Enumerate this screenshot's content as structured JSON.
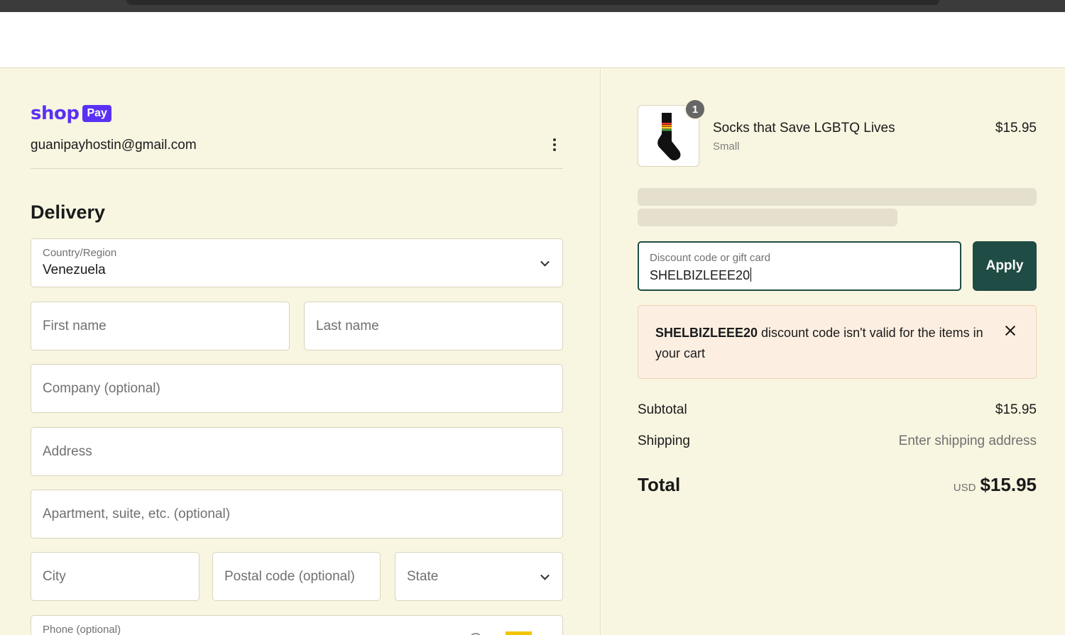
{
  "shop_pay": {
    "shop_text": "shop",
    "pay_text": "Pay",
    "email": "guanipayhostin@gmail.com"
  },
  "delivery": {
    "title": "Delivery",
    "country": {
      "label": "Country/Region",
      "value": "Venezuela"
    },
    "first_name": {
      "placeholder": "First name"
    },
    "last_name": {
      "placeholder": "Last name"
    },
    "company": {
      "placeholder": "Company (optional)"
    },
    "address": {
      "placeholder": "Address"
    },
    "apartment": {
      "placeholder": "Apartment, suite, etc. (optional)"
    },
    "city": {
      "placeholder": "City"
    },
    "postal": {
      "placeholder": "Postal code (optional)"
    },
    "state": {
      "placeholder": "State"
    },
    "phone": {
      "label": "Phone (optional)"
    }
  },
  "summary": {
    "item": {
      "quantity": "1",
      "name": "Socks that Save LGBTQ Lives",
      "variant": "Small",
      "price": "$15.95"
    },
    "discount": {
      "label": "Discount code or gift card",
      "value": "SHELBIZLEEE20",
      "apply_label": "Apply"
    },
    "error": {
      "code": "SHELBIZLEEE20",
      "message": " discount code isn't valid for the items in your cart"
    },
    "subtotal": {
      "label": "Subtotal",
      "value": "$15.95"
    },
    "shipping": {
      "label": "Shipping",
      "value": "Enter shipping address"
    },
    "total": {
      "label": "Total",
      "currency": "USD",
      "value": "$15.95"
    }
  },
  "colors": {
    "background": "#f8f5e1",
    "shop_pay_brand": "#5a31f4",
    "apply_button": "#1f4c44",
    "error_bg": "#fcefe1"
  }
}
